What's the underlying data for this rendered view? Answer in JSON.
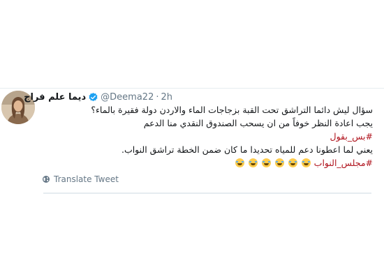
{
  "tweet": {
    "display_name": "ديما علم فراج",
    "handle": "@Deema22",
    "separator": "·",
    "time": "2h",
    "verified": true,
    "lines": [
      "سؤال ليش دائما التراشق تحت القبة بزجاجات الماء والاردن دولة فقيرة بالماء؟",
      "يجب اعادة النظر خوفاً من ان يسحب الصندوق النقدي منا الدعم",
      "#بس_بقول",
      "يعني لما اعطونا دعم للمياه تحديدا ما كان ضمن الخطة تراشق النواب."
    ],
    "hashtag_line_2": "#مجلس_النواب",
    "emoji": [
      "😂",
      "😂",
      "😂",
      "😂",
      "😂",
      "😂"
    ],
    "translate_label": "Translate Tweet"
  },
  "colors": {
    "hashtag": "#b0141e",
    "secondary_text": "#657786",
    "verified_blue": "#1da1f2",
    "divider": "#e6ecf0"
  },
  "icons": {
    "verified": "verified-badge-icon",
    "globe": "globe-icon",
    "emoji": "face-with-tears-of-joy-icon"
  }
}
